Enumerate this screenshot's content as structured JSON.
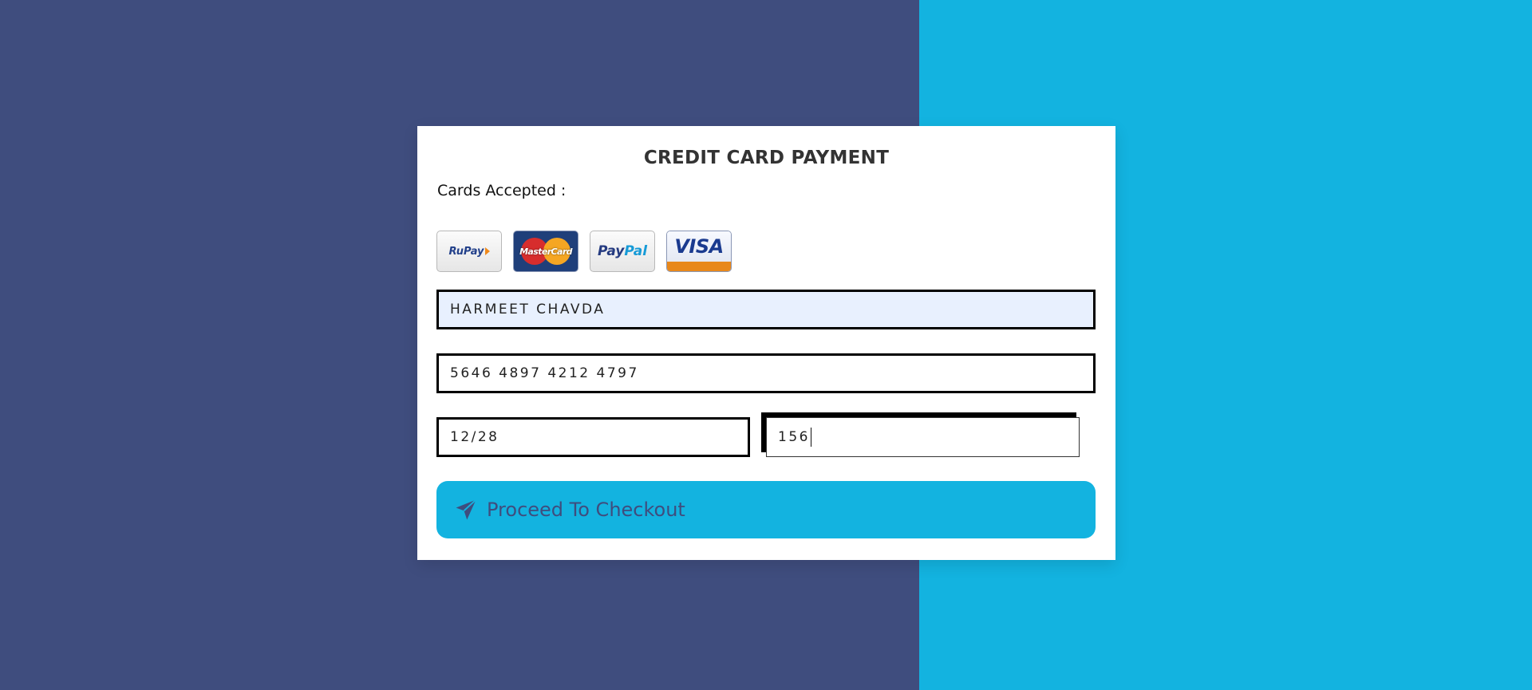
{
  "colors": {
    "background_left": "#3f4d7e",
    "background_right": "#13b3e0",
    "card": "#ffffff",
    "button": "#13b3e0",
    "button_text": "#3f4d7e",
    "autofill_bg": "#e8f0fe"
  },
  "form": {
    "title": "CREDIT CARD PAYMENT",
    "cards_accepted_label": "Cards Accepted :",
    "card_logos": [
      {
        "name": "RuPay",
        "text": "RuPay"
      },
      {
        "name": "MasterCard",
        "text": "MasterCard"
      },
      {
        "name": "PayPal",
        "text_a": "Pay",
        "text_b": "Pal"
      },
      {
        "name": "Visa",
        "text": "VISA"
      }
    ],
    "name_on_card": "HARMEET CHAVDA",
    "card_number": "5646 4897 4212 4797",
    "expiry": "12/28",
    "cvv": "156",
    "checkout_label": "Proceed To Checkout",
    "checkout_icon": "paper-plane-icon"
  }
}
